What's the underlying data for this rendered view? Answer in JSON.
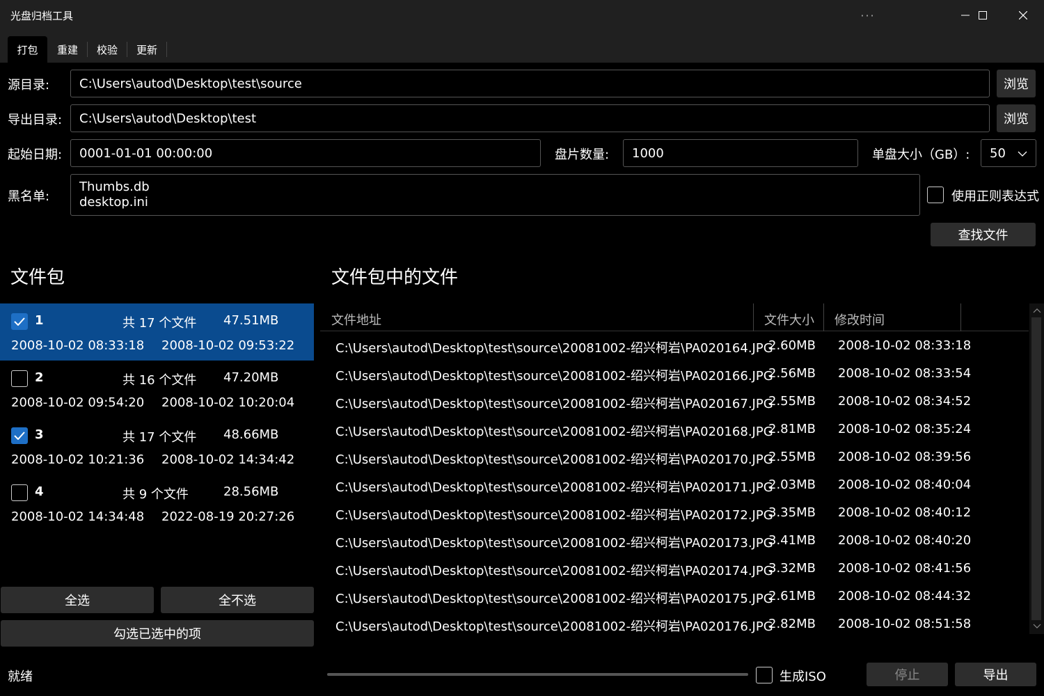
{
  "window": {
    "title": "光盘归档工具",
    "more_glyph": "···",
    "min_glyph": "—",
    "max_glyph": "☐",
    "close_glyph": "✕"
  },
  "tabs": [
    {
      "label": "打包",
      "active": true
    },
    {
      "label": "重建",
      "active": false
    },
    {
      "label": "校验",
      "active": false
    },
    {
      "label": "更新",
      "active": false
    }
  ],
  "form": {
    "source_label": "源目录:",
    "source_value": "C:\\Users\\autod\\Desktop\\test\\source",
    "export_label": "导出目录:",
    "export_value": "C:\\Users\\autod\\Desktop\\test",
    "browse_label": "浏览",
    "start_date_label": "起始日期:",
    "start_date_value": "0001-01-01 00:00:00",
    "disc_count_label": "盘片数量:",
    "disc_count_value": "1000",
    "disc_size_label": "单盘大小（GB）:",
    "disc_size_value": "50",
    "blacklist_label": "黑名单:",
    "blacklist_lines": [
      "Thumbs.db",
      "desktop.ini"
    ],
    "regex_label": "使用正则表达式",
    "regex_checked": false,
    "find_files_label": "查找文件"
  },
  "packages": {
    "heading": "文件包",
    "items": [
      {
        "id": "1",
        "count": "共 17 个文件",
        "size": "47.51MB",
        "start": "2008-10-02 08:33:18",
        "end": "2008-10-02 09:53:22",
        "checked": true,
        "selected": true
      },
      {
        "id": "2",
        "count": "共 16 个文件",
        "size": "47.20MB",
        "start": "2008-10-02 09:54:20",
        "end": "2008-10-02 10:20:04",
        "checked": false,
        "selected": false
      },
      {
        "id": "3",
        "count": "共 17 个文件",
        "size": "48.66MB",
        "start": "2008-10-02 10:21:36",
        "end": "2008-10-02 14:34:42",
        "checked": true,
        "selected": false
      },
      {
        "id": "4",
        "count": "共 9 个文件",
        "size": "28.56MB",
        "start": "2008-10-02 14:34:48",
        "end": "2022-08-19 20:27:26",
        "checked": false,
        "selected": false
      }
    ],
    "select_all_label": "全选",
    "select_none_label": "全不选",
    "check_selected_label": "勾选已选中的项"
  },
  "files": {
    "heading": "文件包中的文件",
    "columns": [
      "文件地址",
      "文件大小",
      "修改时间"
    ],
    "rows": [
      {
        "path": "C:\\Users\\autod\\Desktop\\test\\source\\20081002-绍兴柯岩\\PA020164.JPG",
        "size": "2.60MB",
        "time": "2008-10-02 08:33:18"
      },
      {
        "path": "C:\\Users\\autod\\Desktop\\test\\source\\20081002-绍兴柯岩\\PA020166.JPG",
        "size": "2.56MB",
        "time": "2008-10-02 08:33:54"
      },
      {
        "path": "C:\\Users\\autod\\Desktop\\test\\source\\20081002-绍兴柯岩\\PA020167.JPG",
        "size": "2.55MB",
        "time": "2008-10-02 08:34:52"
      },
      {
        "path": "C:\\Users\\autod\\Desktop\\test\\source\\20081002-绍兴柯岩\\PA020168.JPG",
        "size": "2.81MB",
        "time": "2008-10-02 08:35:24"
      },
      {
        "path": "C:\\Users\\autod\\Desktop\\test\\source\\20081002-绍兴柯岩\\PA020170.JPG",
        "size": "2.55MB",
        "time": "2008-10-02 08:39:56"
      },
      {
        "path": "C:\\Users\\autod\\Desktop\\test\\source\\20081002-绍兴柯岩\\PA020171.JPG",
        "size": "2.03MB",
        "time": "2008-10-02 08:40:04"
      },
      {
        "path": "C:\\Users\\autod\\Desktop\\test\\source\\20081002-绍兴柯岩\\PA020172.JPG",
        "size": "3.35MB",
        "time": "2008-10-02 08:40:12"
      },
      {
        "path": "C:\\Users\\autod\\Desktop\\test\\source\\20081002-绍兴柯岩\\PA020173.JPG",
        "size": "3.41MB",
        "time": "2008-10-02 08:40:20"
      },
      {
        "path": "C:\\Users\\autod\\Desktop\\test\\source\\20081002-绍兴柯岩\\PA020174.JPG",
        "size": "3.32MB",
        "time": "2008-10-02 08:41:56"
      },
      {
        "path": "C:\\Users\\autod\\Desktop\\test\\source\\20081002-绍兴柯岩\\PA020175.JPG",
        "size": "2.61MB",
        "time": "2008-10-02 08:44:32"
      },
      {
        "path": "C:\\Users\\autod\\Desktop\\test\\source\\20081002-绍兴柯岩\\PA020176.JPG",
        "size": "2.82MB",
        "time": "2008-10-02 08:51:58"
      }
    ]
  },
  "status": {
    "text": "就绪",
    "progress": 0,
    "iso_label": "生成ISO",
    "iso_checked": false,
    "stop_label": "停止",
    "export_label": "导出"
  },
  "colors": {
    "background": "#000000",
    "titlebar": "#202020",
    "selection": "#0a4b8f",
    "checkbox_accent": "#1e6fc5",
    "button": "#2d2d2d"
  }
}
